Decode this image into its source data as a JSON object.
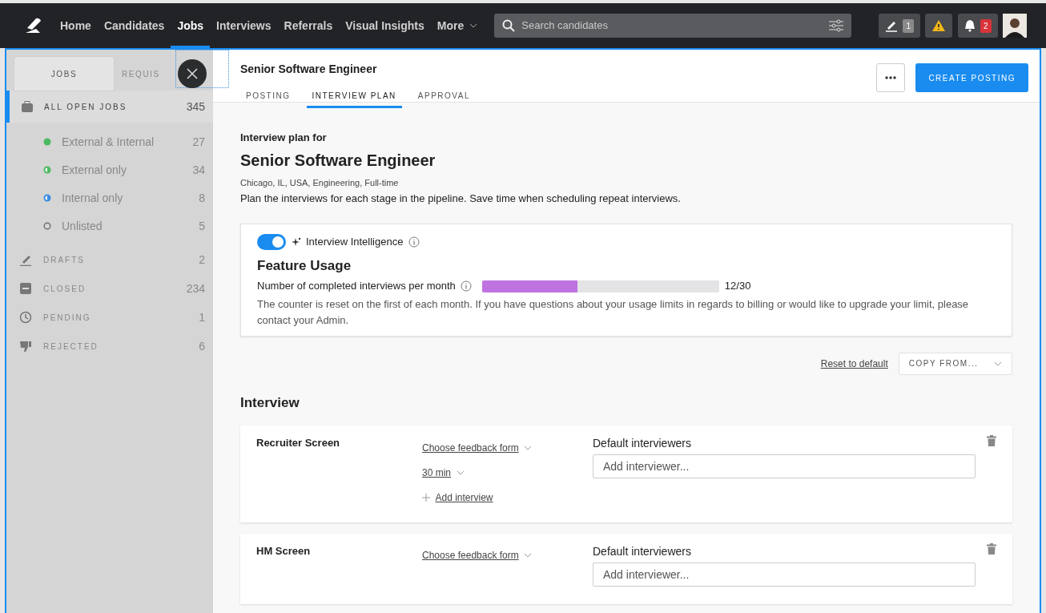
{
  "navbar": {
    "items": [
      {
        "label": "Home",
        "selected": false
      },
      {
        "label": "Candidates",
        "selected": false
      },
      {
        "label": "Jobs",
        "selected": true
      },
      {
        "label": "Interviews",
        "selected": false
      },
      {
        "label": "Referrals",
        "selected": false
      },
      {
        "label": "Visual Insights",
        "selected": false
      }
    ],
    "more": "More",
    "search": {
      "placeholder": "Search candidates"
    },
    "drafts_count": "1",
    "notifications_count": "2"
  },
  "sidebar": {
    "tabs": [
      {
        "label": "JOBS",
        "selected": true
      },
      {
        "label": "REQUIS",
        "selected": false
      }
    ],
    "all_open": {
      "label": "ALL OPEN JOBS",
      "count": "345",
      "selected": true
    },
    "visibility": [
      {
        "label": "External & Internal",
        "count": "27",
        "kind": "full",
        "color": "#4cb963"
      },
      {
        "label": "External only",
        "count": "34",
        "kind": "half",
        "color": "#4cb963"
      },
      {
        "label": "Internal only",
        "count": "8",
        "kind": "half",
        "color": "#3b8fe0"
      },
      {
        "label": "Unlisted",
        "count": "5",
        "kind": "outline",
        "color": "#6f6f6f"
      }
    ],
    "sections": [
      {
        "label": "DRAFTS",
        "count": "2",
        "kind": "drafts"
      },
      {
        "label": "CLOSED",
        "count": "234",
        "kind": "closed"
      },
      {
        "label": "PENDING",
        "count": "1",
        "kind": "pending"
      },
      {
        "label": "REJECTED",
        "count": "6",
        "kind": "rejected"
      }
    ]
  },
  "header": {
    "title": "Senior Software Engineer",
    "tabs": [
      {
        "label": "POSTING",
        "selected": false
      },
      {
        "label": "INTERVIEW PLAN",
        "selected": true
      },
      {
        "label": "APPROVAL",
        "selected": false
      }
    ],
    "create_button": "CREATE POSTING"
  },
  "plan": {
    "intro": "Interview plan for",
    "title": "Senior Software Engineer",
    "meta": "Chicago, IL, USA, Engineering, Full-time",
    "description": "Plan the interviews for each stage in the pipeline. Save time when scheduling repeat interviews.",
    "intelligence": {
      "on": true,
      "label": "Interview Intelligence",
      "heading": "Feature Usage",
      "usage_label": "Number of completed interviews per month",
      "level": 0.4,
      "reading": "12/30",
      "note": "The counter is reset on the first of each month. If you have questions about your usage limits in regards to billing or would like to upgrade your limit, please contact your Admin."
    },
    "reset_link": "Reset to default",
    "copy_button": "COPY FROM...",
    "section_title": "Interview",
    "stages": [
      {
        "name": "Recruiter Screen",
        "feedback_form": "Choose feedback form",
        "duration": "30 min",
        "add_interview": "Add interview",
        "interviewers_label": "Default interviewers",
        "placeholder": "Add interviewer..."
      },
      {
        "name": "HM Screen",
        "feedback_form": "Choose feedback form",
        "interviewers_label": "Default interviewers",
        "placeholder": "Add interviewer..."
      }
    ]
  }
}
